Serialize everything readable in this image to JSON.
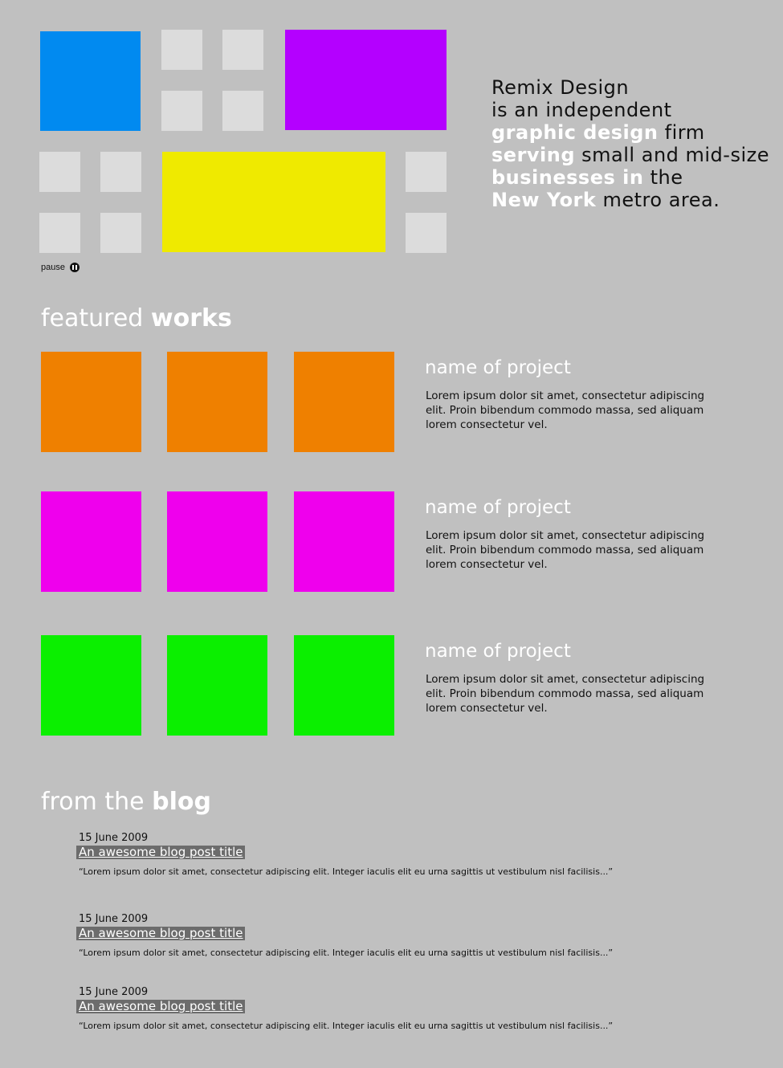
{
  "hero": {
    "tile_colors": {
      "blue": "#018af0",
      "purple": "#b400ff",
      "yellow": "#efea00",
      "gray": "#dcdcdc"
    },
    "pause_label": "pause",
    "pause_icon": "pause-circle-icon"
  },
  "intro": {
    "lines": [
      [
        {
          "t": "Remix Design",
          "hl": false
        }
      ],
      [
        {
          "t": "is an independent",
          "hl": false
        }
      ],
      [
        {
          "t": "graphic design",
          "hl": true
        },
        {
          "t": " firm",
          "hl": false
        }
      ],
      [
        {
          "t": "serving",
          "hl": true
        },
        {
          "t": " small and mid-size",
          "hl": false
        }
      ],
      [
        {
          "t": "businesses in",
          "hl": true
        },
        {
          "t": " the",
          "hl": false
        }
      ],
      [
        {
          "t": "New York",
          "hl": true
        },
        {
          "t": " metro area.",
          "hl": false
        }
      ]
    ]
  },
  "featured": {
    "heading_light": "featured ",
    "heading_bold": "works",
    "projects": [
      {
        "name": "name of project",
        "description": "Lorem ipsum dolor sit amet, consectetur adipiscing elit. Proin bibendum commodo massa, sed aliquam lorem consectetur vel.",
        "color": "#ef8000"
      },
      {
        "name": "name of project",
        "description": "Lorem ipsum dolor sit amet, consectetur adipiscing elit. Proin bibendum commodo massa, sed aliquam lorem consectetur vel.",
        "color": "#ef00ed"
      },
      {
        "name": "name of project",
        "description": "Lorem ipsum dolor sit amet, consectetur adipiscing elit. Proin bibendum commodo massa, sed aliquam lorem consectetur vel.",
        "color": "#0bef00"
      }
    ]
  },
  "blog": {
    "heading_light": "from the ",
    "heading_bold": "blog",
    "posts": [
      {
        "date": "15 June 2009",
        "title": "An awesome blog post title",
        "excerpt": "“Lorem ipsum dolor sit amet, consectetur adipiscing elit. Integer iaculis elit eu urna sagittis ut vestibulum nisl facilisis...”"
      },
      {
        "date": "15 June 2009",
        "title": "An awesome blog post title",
        "excerpt": "“Lorem ipsum dolor sit amet, consectetur adipiscing elit. Integer iaculis elit eu urna sagittis ut vestibulum nisl facilisis...”"
      },
      {
        "date": "15 June 2009",
        "title": "An awesome blog post title",
        "excerpt": "“Lorem ipsum dolor sit amet, consectetur adipiscing elit. Integer iaculis elit eu urna sagittis ut vestibulum nisl facilisis...”"
      }
    ]
  }
}
